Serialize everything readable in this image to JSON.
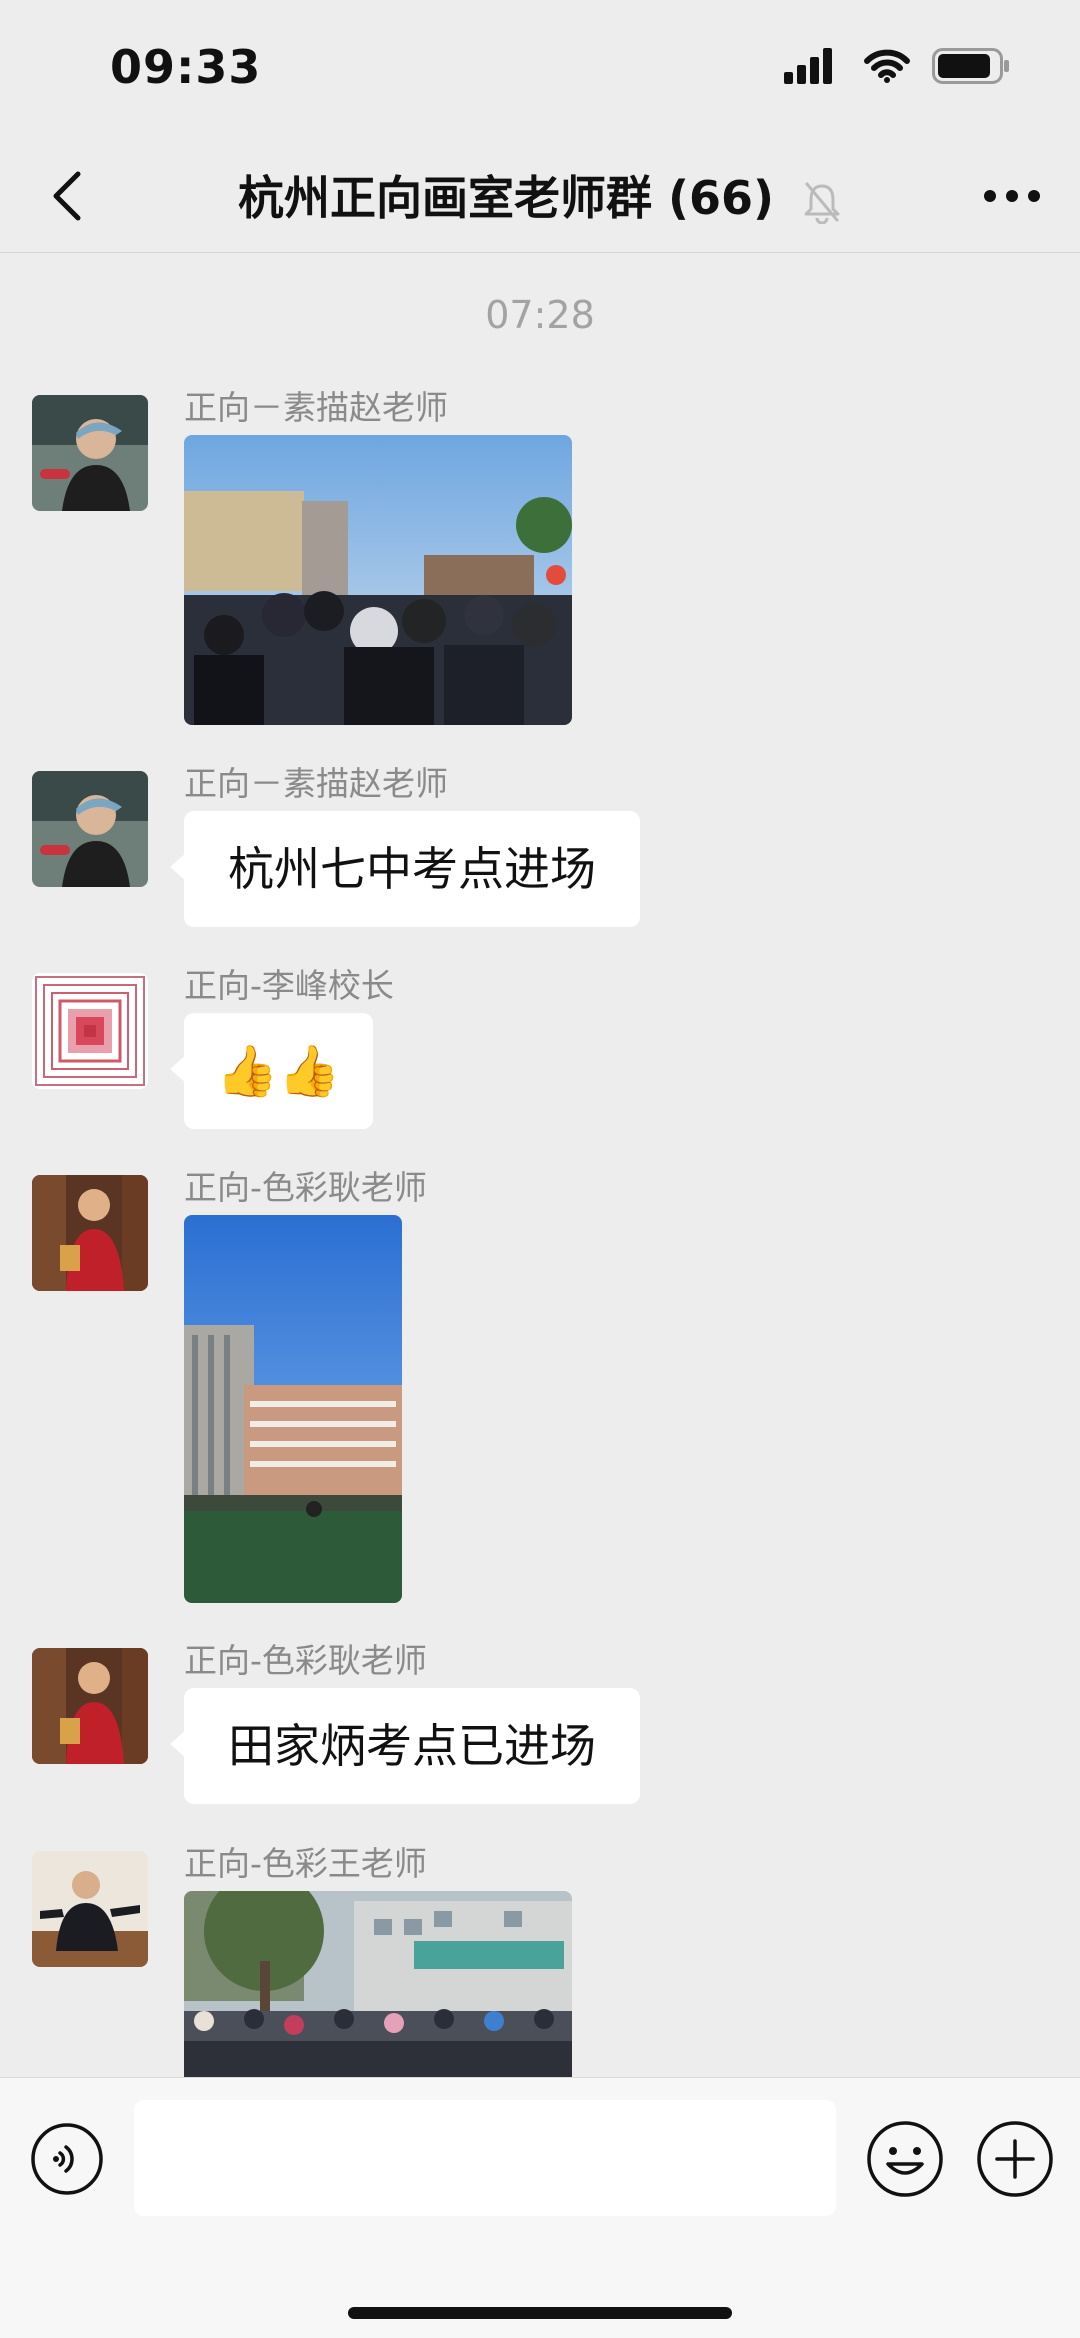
{
  "status_bar": {
    "time": "09:33"
  },
  "header": {
    "title": "杭州正向画室老师群 (66)",
    "muted": true
  },
  "chat": {
    "timestamp": "07:28",
    "messages": [
      {
        "sender": "正向－素描赵老师",
        "type": "image",
        "avatar": "avatar-zhao"
      },
      {
        "sender": "正向－素描赵老师",
        "type": "text",
        "text": "杭州七中考点进场",
        "avatar": "avatar-zhao"
      },
      {
        "sender": "正向-李峰校长",
        "type": "emoji",
        "text": "👍👍",
        "avatar": "avatar-li"
      },
      {
        "sender": "正向-色彩耿老师",
        "type": "image",
        "avatar": "avatar-geng"
      },
      {
        "sender": "正向-色彩耿老师",
        "type": "text",
        "text": "田家炳考点已进场",
        "avatar": "avatar-geng"
      },
      {
        "sender": "正向-色彩王老师",
        "type": "image",
        "avatar": "avatar-wang"
      }
    ]
  },
  "colors": {
    "background": "#ededed",
    "bubble": "#ffffff",
    "sender_text": "#8a8a8a"
  },
  "icons": [
    "signal-icon",
    "wifi-icon",
    "battery-icon",
    "back-icon",
    "mute-bell-icon",
    "more-icon",
    "voice-icon",
    "emoji-icon",
    "plus-icon"
  ]
}
